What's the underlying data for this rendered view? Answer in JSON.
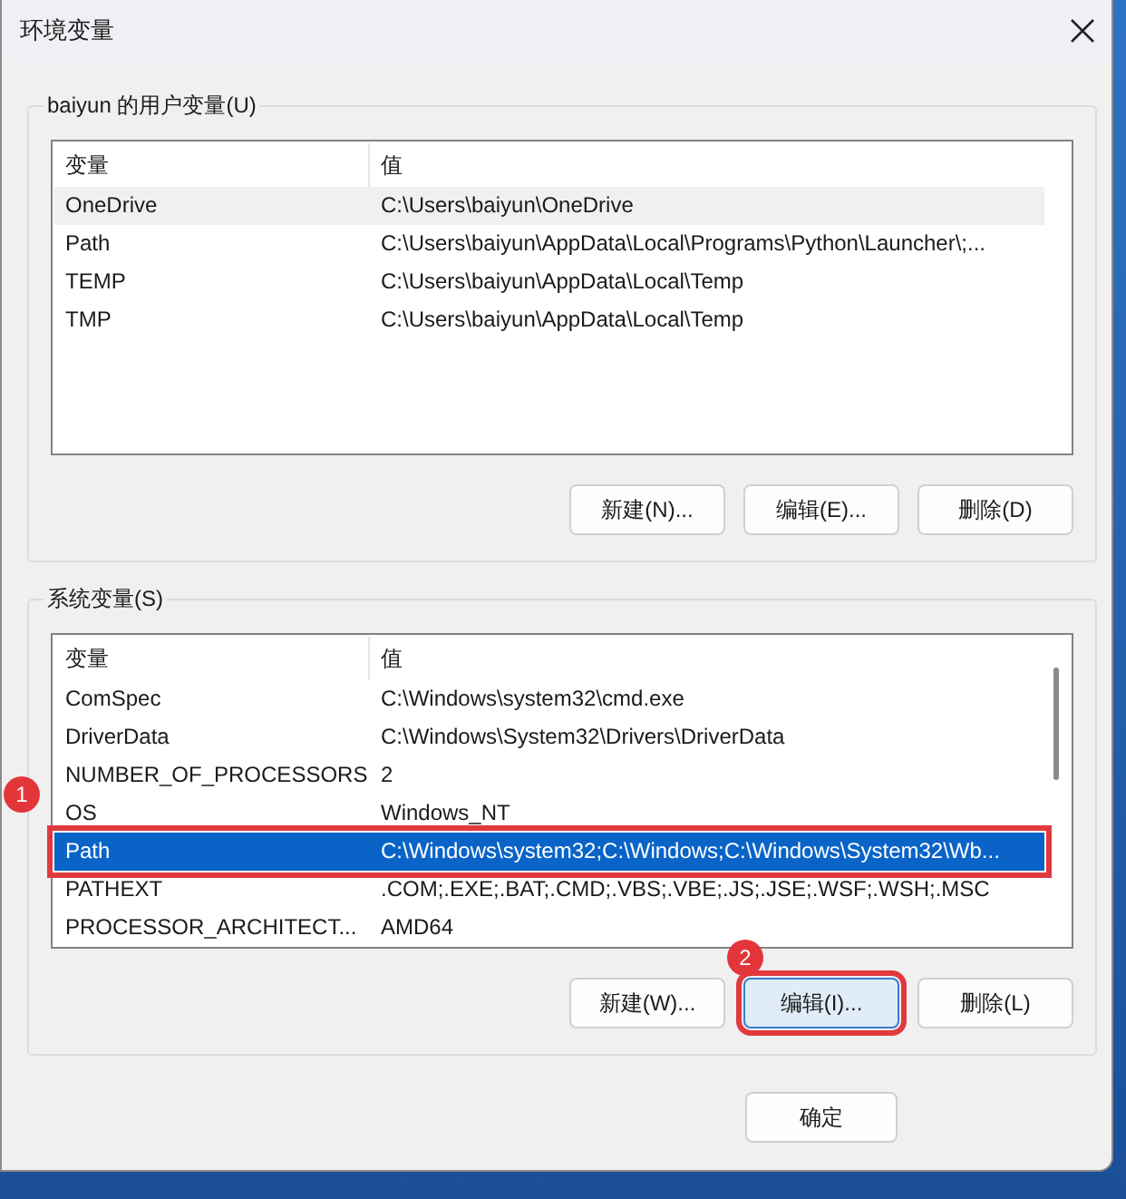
{
  "window": {
    "title": "环境变量"
  },
  "user_variables": {
    "label": "baiyun 的用户变量(U)",
    "focused": false,
    "scrollbar": false,
    "columns": [
      "变量",
      "值"
    ],
    "rows": [
      {
        "name": "OneDrive",
        "value": "C:\\Users\\baiyun\\OneDrive",
        "selected": true,
        "outlined": false
      },
      {
        "name": "Path",
        "value": "C:\\Users\\baiyun\\AppData\\Local\\Programs\\Python\\Launcher\\;...",
        "selected": false,
        "outlined": false
      },
      {
        "name": "TEMP",
        "value": "C:\\Users\\baiyun\\AppData\\Local\\Temp",
        "selected": false,
        "outlined": false
      },
      {
        "name": "TMP",
        "value": "C:\\Users\\baiyun\\AppData\\Local\\Temp",
        "selected": false,
        "outlined": false
      }
    ],
    "buttons": [
      {
        "label": "新建(N)...",
        "focused": false,
        "outlined": false
      },
      {
        "label": "编辑(E)...",
        "focused": false,
        "outlined": false
      },
      {
        "label": "删除(D)",
        "focused": false,
        "outlined": false
      }
    ]
  },
  "system_variables": {
    "label": "系统变量(S)",
    "focused": true,
    "scrollbar": true,
    "columns": [
      "变量",
      "值"
    ],
    "rows": [
      {
        "name": "ComSpec",
        "value": "C:\\Windows\\system32\\cmd.exe",
        "selected": false,
        "outlined": false
      },
      {
        "name": "DriverData",
        "value": "C:\\Windows\\System32\\Drivers\\DriverData",
        "selected": false,
        "outlined": false
      },
      {
        "name": "NUMBER_OF_PROCESSORS",
        "value": "2",
        "selected": false,
        "outlined": false
      },
      {
        "name": "OS",
        "value": "Windows_NT",
        "selected": false,
        "outlined": false,
        "badge": "1"
      },
      {
        "name": "Path",
        "value": "C:\\Windows\\system32;C:\\Windows;C:\\Windows\\System32\\Wb...",
        "selected": true,
        "outlined": true
      },
      {
        "name": "PATHEXT",
        "value": ".COM;.EXE;.BAT;.CMD;.VBS;.VBE;.JS;.JSE;.WSF;.WSH;.MSC",
        "selected": false,
        "outlined": false
      },
      {
        "name": "PROCESSOR_ARCHITECT...",
        "value": "AMD64",
        "selected": false,
        "outlined": false
      }
    ],
    "buttons": [
      {
        "label": "新建(W)...",
        "focused": false,
        "outlined": false
      },
      {
        "label": "编辑(I)...",
        "focused": true,
        "outlined": true,
        "badge": "2"
      },
      {
        "label": "删除(L)",
        "focused": false,
        "outlined": false
      }
    ]
  },
  "ok_button": {
    "label": "确定"
  }
}
